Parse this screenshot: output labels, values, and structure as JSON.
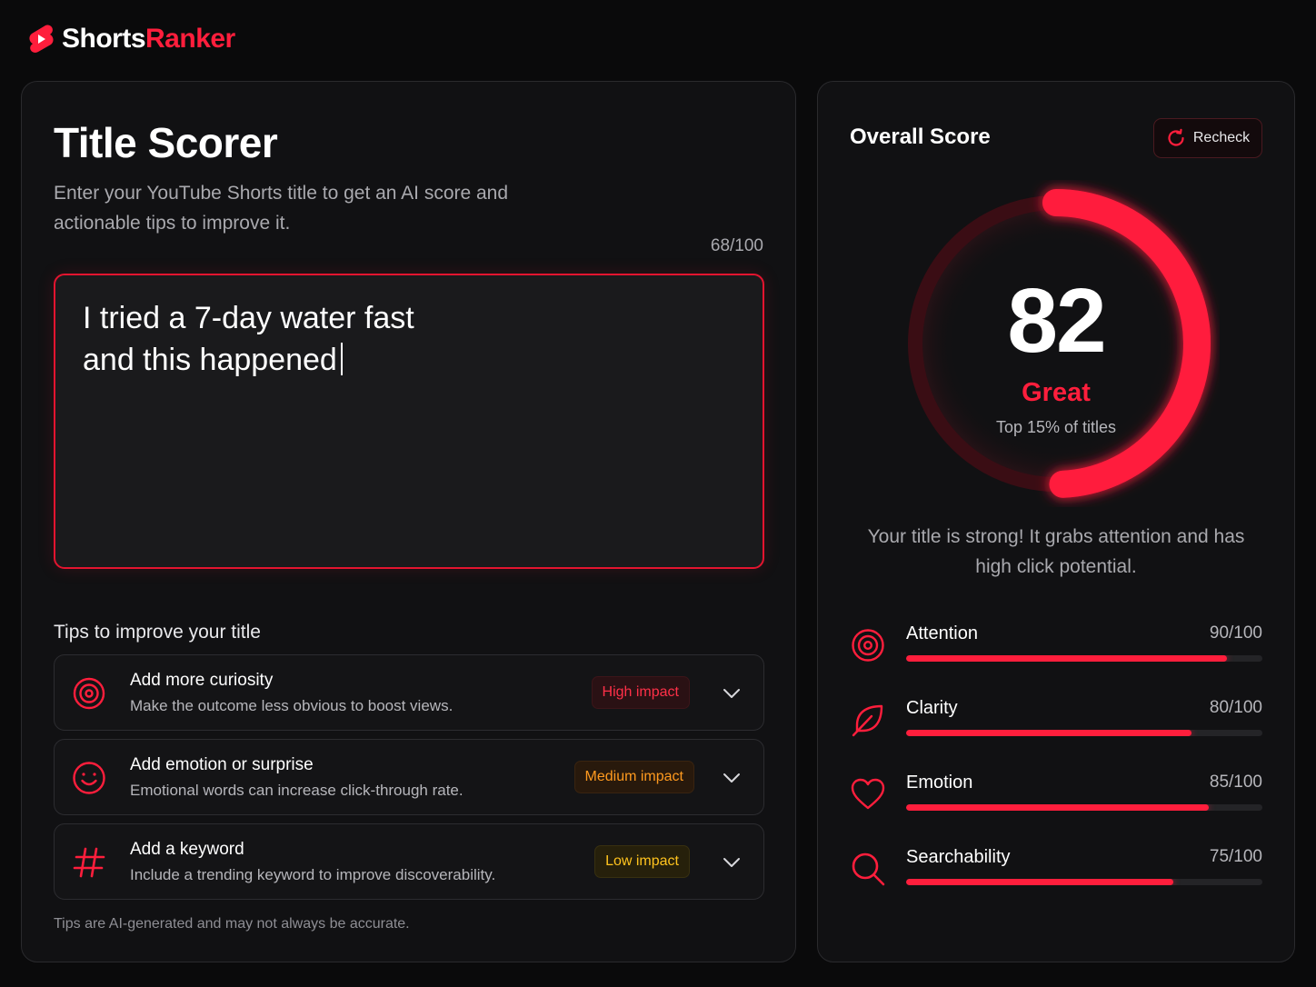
{
  "brand": {
    "name_part1": "Shorts",
    "name_part2": "Ranker"
  },
  "colors": {
    "accent": "#ff1e3c",
    "background": "#0a0a0b",
    "panel": "#111113",
    "medium": "#ff9a1f",
    "low": "#ffc31e"
  },
  "scorer": {
    "title": "Title Scorer",
    "subtitle": "Enter your YouTube Shorts title to get an AI score and actionable tips to improve it.",
    "char_count": "68/100",
    "input_value": "I tried a 7-day water fast\nand this happened",
    "tips_heading": "Tips to improve your title",
    "tips": [
      {
        "icon": "target-icon",
        "title": "Add more curiosity",
        "description": "Make the outcome less obvious to boost views.",
        "impact": "High impact"
      },
      {
        "icon": "smiley-icon",
        "title": "Add emotion or surprise",
        "description": "Emotional words can increase click-through rate.",
        "impact": "Medium impact"
      },
      {
        "icon": "hashtag-icon",
        "title": "Add a keyword",
        "description": "Include a trending keyword to improve discoverability.",
        "impact": "Low impact"
      }
    ],
    "disclaimer": "Tips are AI-generated and may not always be accurate."
  },
  "overall": {
    "title": "Overall Score",
    "recheck_label": "Recheck",
    "score": 82,
    "score_display": "82",
    "max": 100,
    "grade": "Great",
    "rank": "Top 15% of titles",
    "summary": "Your title is strong! It grabs attention and has high click potential.",
    "metrics": [
      {
        "icon": "target-icon",
        "label": "Attention",
        "value": "90/100",
        "fraction": 0.9
      },
      {
        "icon": "leaf-icon",
        "label": "Clarity",
        "value": "80/100",
        "fraction": 0.8
      },
      {
        "icon": "heart-icon",
        "label": "Emotion",
        "value": "85/100",
        "fraction": 0.85
      },
      {
        "icon": "search-icon",
        "label": "Searchability",
        "value": "75/100",
        "fraction": 0.75
      }
    ]
  }
}
